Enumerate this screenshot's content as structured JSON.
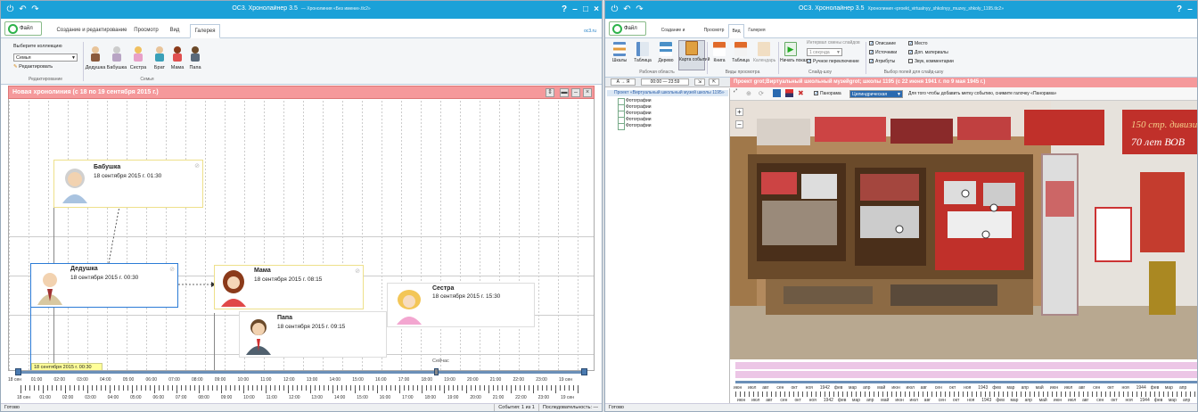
{
  "left": {
    "title": "OC3. Хронолайнер 3.5",
    "title_sub": "— Хронолиния «Без имени».tlc2»",
    "file_tab": "Файл",
    "tabs": [
      "Создание и редактирование",
      "Просмотр",
      "Вид",
      "Галерея"
    ],
    "site": "oc3.ru",
    "ribbon": {
      "collection_label": "Выберите коллекцию",
      "collection_value": "Семья",
      "edit_label": "Редактировать",
      "group_edit": "Редактирование",
      "group_family": "Семья",
      "persons": [
        "Дедушка",
        "Бабушка",
        "Сестра",
        "Брат",
        "Мама",
        "Папа"
      ]
    },
    "timeline_title": "Новая хронолиния (с 18 по 19 сентября 2015 г.)",
    "cards": [
      {
        "name": "Бабушка",
        "date": "18 сентября 2015 г. 01:30"
      },
      {
        "name": "Дедушка",
        "date": "18 сентября 2015 г. 00:30"
      },
      {
        "name": "Мама",
        "date": "18 сентября 2015 г. 08:15"
      },
      {
        "name": "Сестра",
        "date": "18 сентября 2015 г. 15:30"
      },
      {
        "name": "Папа",
        "date": "18 сентября 2015 г. 09:15"
      }
    ],
    "tooltip": "18 сентября 2015 г. 00:30",
    "now_label": "Сейчас",
    "scale_ticks": [
      "18 сен",
      "01:00",
      "02:00",
      "03:00",
      "04:00",
      "05:00",
      "06:00",
      "07:00",
      "08:00",
      "09:00",
      "10:00",
      "11:00",
      "12:00",
      "13:00",
      "14:00",
      "15:00",
      "16:00",
      "17:00",
      "18:00",
      "19:00",
      "20:00",
      "21:00",
      "22:00",
      "23:00",
      "19 сен"
    ],
    "status_left": "Готово",
    "status_events": "События: 1 из 1",
    "status_seq": "Последовательность: —"
  },
  "right": {
    "title": "OC3. Хронолайнер 3.5",
    "title_sub": "Хронолиния «proekt_virtualnyy_shkolnyy_muzey_shkoly_1195.tlc2»",
    "file_tab": "Файл",
    "tabs": [
      "Создание и редактирование",
      "Просмотр",
      "Вид",
      "Галерея"
    ],
    "ribbon_views": [
      "Шкалы",
      "Таблица",
      "Дерево",
      "Карта событий",
      "Книга",
      "Таблица",
      "Календарь"
    ],
    "group_workarea": "Рабочая область",
    "group_views": "Виды просмотра",
    "start_label": "Начать показ",
    "interval_label": "Интервал смены слайдов",
    "interval_value": "1 секунда",
    "manual_switch": "Ручное переключение",
    "group_slideshow": "Слайд-шоу",
    "fields": [
      "Описание",
      "Место",
      "Источники",
      "Доп. материалы",
      "Атрибуты",
      "Звук, комментарии"
    ],
    "group_fields": "Выбор полей для слайд-шоу",
    "nav_az": "А → Я",
    "nav_time": "00:00 — 23:59",
    "tree_root": "Проект «Виртуальный школьный музей школы 1195»",
    "tree_items": [
      "Фотографии",
      "Фотографии",
      "Фотографии",
      "Фотографии",
      "Фотографии"
    ],
    "header": "Проект grot;Виртуальный школьный музейgrot; школы 1195 (с 22 июня 1941 г. по 9 мая 1945 г.)",
    "panorama_label": "Панорама",
    "panorama_mode": "Цилиндрическая",
    "hint": "Для того чтобы добавить метку событию, снимите галочку «Панорама»",
    "poster_text1": "150 стр. дивизия",
    "poster_text2": "70 лет ВОВ",
    "scale_ticks": [
      "июн",
      "июл",
      "авг",
      "сен",
      "окт",
      "ноя",
      "1942",
      "фев",
      "мар",
      "апр",
      "май",
      "июн",
      "июл",
      "авг",
      "сен",
      "окт",
      "ноя",
      "1943",
      "фев",
      "мар",
      "апр",
      "май",
      "июн",
      "июл",
      "авг",
      "сен",
      "окт",
      "ноя",
      "1944",
      "фев",
      "мар",
      "апр"
    ],
    "status_left": "Готово"
  }
}
